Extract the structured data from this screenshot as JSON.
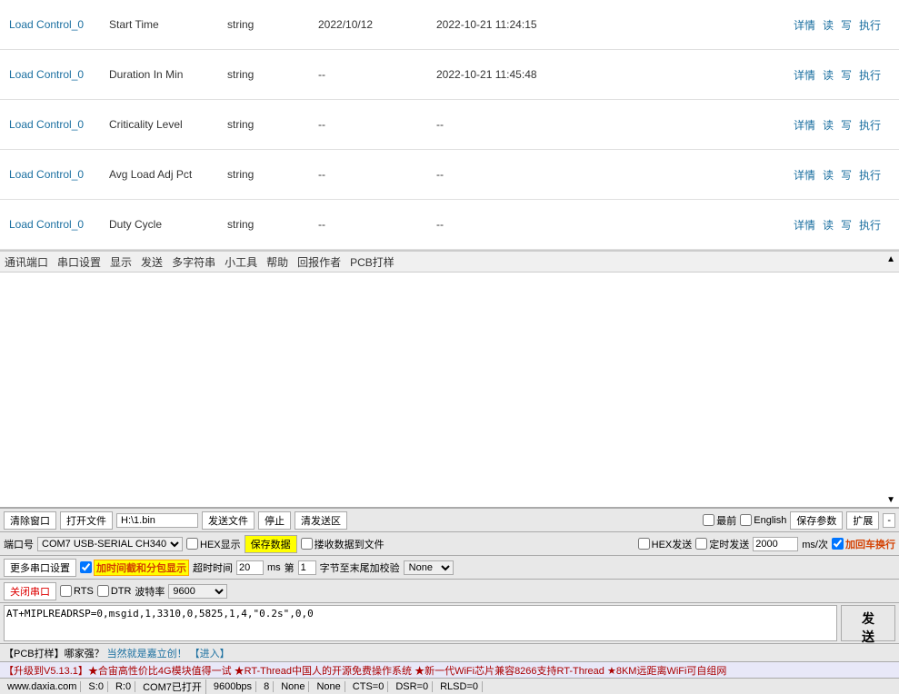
{
  "table": {
    "rows": [
      {
        "name": "Load Control_0",
        "attr": "Start Time",
        "type": "string",
        "val1": "2022/10/12",
        "val2": "2022-10-21 11:24:15",
        "actions": [
          "详情",
          "读",
          "写",
          "执行"
        ]
      },
      {
        "name": "Load Control_0",
        "attr": "Duration In Min",
        "type": "string",
        "val1": "--",
        "val2": "2022-10-21 11:45:48",
        "actions": [
          "详情",
          "读",
          "写",
          "执行"
        ]
      },
      {
        "name": "Load Control_0",
        "attr": "Criticality Level",
        "type": "string",
        "val1": "--",
        "val2": "--",
        "actions": [
          "详情",
          "读",
          "写",
          "执行"
        ]
      },
      {
        "name": "Load Control_0",
        "attr": "Avg Load Adj Pct",
        "type": "string",
        "val1": "--",
        "val2": "--",
        "actions": [
          "详情",
          "读",
          "写",
          "执行"
        ]
      },
      {
        "name": "Load Control_0",
        "attr": "Duty Cycle",
        "type": "string",
        "val1": "--",
        "val2": "--",
        "actions": [
          "详情",
          "读",
          "写",
          "执行"
        ]
      }
    ]
  },
  "toolbar": {
    "items": [
      "通讯端口",
      "串口设置",
      "显示",
      "发送",
      "多字符串",
      "小工具",
      "帮助",
      "回报作者",
      "PCB打样"
    ]
  },
  "bottom": {
    "row1": {
      "clear_btn": "清除窗口",
      "open_btn": "打开文件",
      "file_path": "H:\\1.bin",
      "send_file_btn": "发送文件",
      "stop_btn": "停止",
      "clear_send_btn": "清发送区",
      "latest_label": "最前",
      "english_label": "English",
      "save_param_btn": "保存参数",
      "expand_btn": "扩展",
      "close_btn": "-"
    },
    "row2": {
      "port_label": "端口号",
      "port_value": "COM7 USB-SERIAL CH340",
      "hex_display_check": "HEX显示",
      "save_data_btn": "保存数据",
      "recv_to_file_check": "搂收数据到文件",
      "hex_send_check": "HEX发送",
      "timed_send_check": "定时发送",
      "ms_value": "2000",
      "ms_unit": "ms/次",
      "add_newline_btn": "加回车换行"
    },
    "row3": {
      "more_settings_btn": "更多串口设置",
      "add_timestamp_check": "加时间截和分包显示",
      "timeout_label": "超时时间",
      "timeout_value": "20",
      "ms_label": "ms",
      "page_label": "第",
      "page_value": "1",
      "byte_label": "字节至末尾加校验",
      "crc_select": "None"
    },
    "row4": {
      "close_port_btn": "关闭串口",
      "rts_check": "RTS",
      "dtr_check": "DTR",
      "baud_label": "波特率",
      "baud_value": "9600"
    },
    "send_content": "AT+MIPLREADRSP=0,msgid,1,3310,0,5825,1,4,\"0.2s\",0,0",
    "send_btn": "发 送",
    "pcb_row": {
      "text": "【PCB打样】哪家强？",
      "link": "当然就是嘉立创！",
      "link2": "【进入】"
    },
    "news": "【升级到V5.13.1】★合宙高性价比4G模块值得一试 ★RT-Thread中国人的开源免费操作系统 ★新一代WiFi芯片兼容8266支持RT-Thread ★8KM远距离WiFi可自组网",
    "status_bar": {
      "site": "www.daxia.com",
      "s0": "S:0",
      "r0": "R:0",
      "port": "COM7已打开",
      "baud": "9600bps",
      "bits": "8",
      "parity": "None",
      "stop": "None",
      "cts": "CTS=0",
      "dsr": "DSR=0",
      "rlsd": "RLSD=0"
    }
  }
}
